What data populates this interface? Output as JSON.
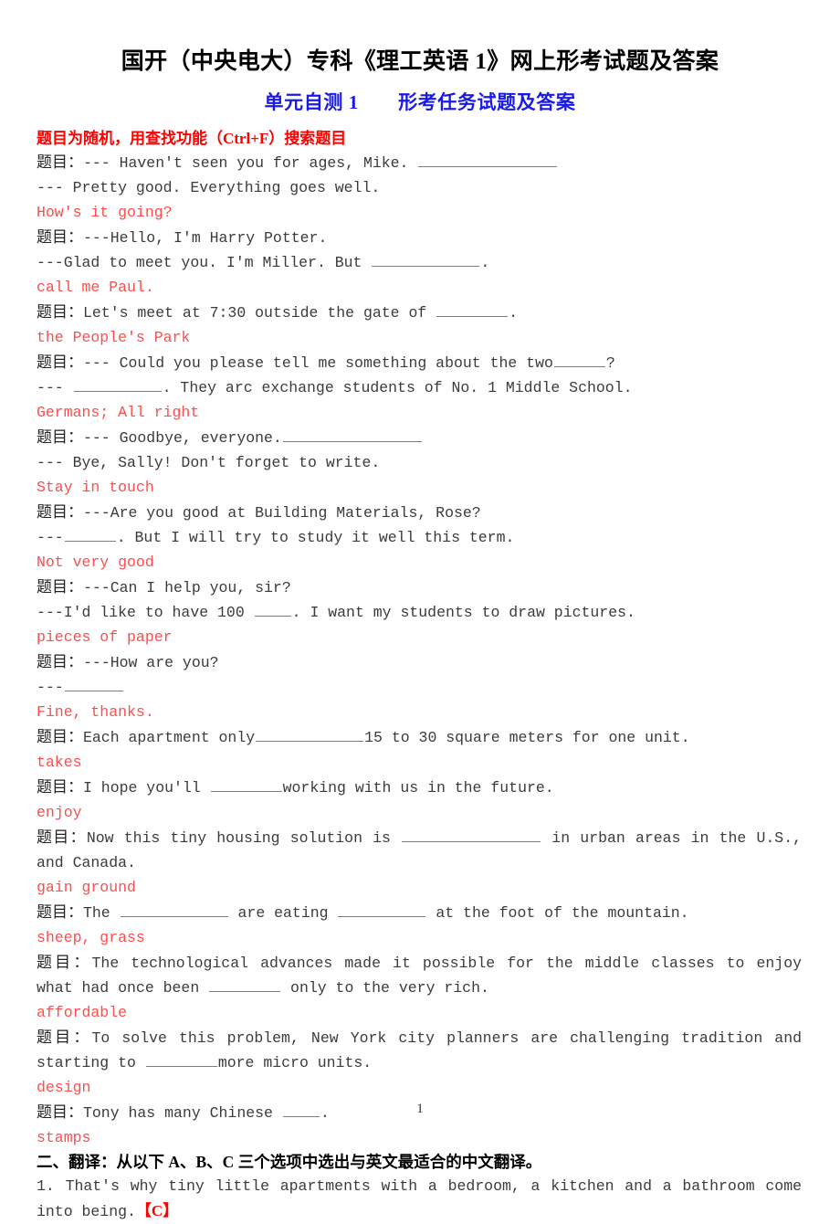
{
  "document": {
    "title": "国开（中央电大）专科《理工英语 1》网上形考试题及答案",
    "subtitle": "单元自测 1　　形考任务试题及答案",
    "notice": "题目为随机，用查找功能（Ctrl+F）搜索题目",
    "page_number": "1"
  },
  "colors": {
    "title": "#000000",
    "subtitle": "#1a1ae6",
    "notice": "#fe0000",
    "question": "#3b3b3b",
    "answer": "#fe4d4d",
    "answer_mark": "#fe0000",
    "blank_rule": "#7d7d7d",
    "background": "#ffffff"
  },
  "items": [
    {
      "label": "题目：",
      "q_line1_pre": "--- Haven't seen you for ages, Mike. ",
      "q_line1_blank": "xl",
      "q_line1_post": "",
      "q_line2": "--- Pretty good. Everything goes well.",
      "answer": "How's it going?"
    },
    {
      "label": "题目：",
      "q_line1_pre": "---Hello, I'm Harry Potter.",
      "q_line2_pre": "---Glad to meet you. I'm Miller. But ",
      "q_line2_blank": "lg",
      "q_line2_post": ".",
      "answer": "call me Paul."
    },
    {
      "label": "题目：",
      "q_line1_pre": "Let's meet at 7:30 outside the gate of ",
      "q_line1_blank": "sm",
      "q_line1_post": ".",
      "answer": "the People's Park"
    },
    {
      "label": "题目：",
      "q_line1_pre": "--- Could you please tell me something about the two",
      "q_line1_blank": "xs",
      "q_line1_post": "?",
      "q_line2_pre": "--- ",
      "q_line2_blank": "md",
      "q_line2_post": ". They arc exchange students of No. 1 Middle School.",
      "answer": "Germans; All right"
    },
    {
      "label": "题目：",
      "q_line1_pre": "--- Goodbye, everyone.",
      "q_line1_blank": "xl",
      "q_line1_post": "",
      "q_line2": "--- Bye, Sally! Don't forget to write.",
      "answer": "Stay in touch"
    },
    {
      "label": "题目：",
      "q_line1_pre": "---Are you good at Building Materials, Rose?",
      "q_line2_pre": "---",
      "q_line2_blank": "xs",
      "q_line2_post": ". But I will try to study it well this term.",
      "answer": "Not very good"
    },
    {
      "label": "题目：",
      "q_line1_pre": "---Can I help you, sir?",
      "q_line2_pre": "---I'd like to have 100 ",
      "q_line2_blank": "xxs",
      "q_line2_post": ". I want my students to draw pictures.",
      "answer": "pieces of paper"
    },
    {
      "label": "题目：",
      "q_line1_pre": "---How are you?",
      "q_line2_pre": "---",
      "q_line2_blank": "tiny",
      "q_line2_post": "",
      "answer": "Fine, thanks."
    },
    {
      "label": "题目：",
      "q_line1_pre": "Each apartment only",
      "q_line1_blank": "lg",
      "q_line1_post": "15 to 30 square meters for one unit.",
      "answer": "takes"
    },
    {
      "label": "题目：",
      "q_line1_pre": "I hope you'll ",
      "q_line1_blank": "sm",
      "q_line1_post": "working with us in the future.",
      "answer": "enjoy"
    },
    {
      "label": "题目：",
      "q_line1_pre": "Now this tiny housing solution is ",
      "q_line1_blank": "xl",
      "q_line1_post": " in urban areas in the U.S., and Canada.",
      "answer": "gain ground"
    },
    {
      "label": "题目：",
      "q_line1_pre": "The ",
      "q_line1_blank": "lg",
      "q_line1_mid": " are eating ",
      "q_line1_blank2": "md",
      "q_line1_post": " at the foot of the mountain.",
      "answer": "sheep, grass"
    },
    {
      "label": "题目：",
      "q_line1_pre": "The technological advances made it possible for the middle classes to enjoy what had once been ",
      "q_line1_blank": "sm",
      "q_line1_post": " only to the very rich.",
      "answer": "affordable"
    },
    {
      "label": "题目：",
      "q_line1_pre": "To solve this problem, New York city planners are challenging tradition and starting to ",
      "q_line1_blank": "sm",
      "q_line1_post": "more micro units.",
      "answer": "design"
    },
    {
      "label": "题目：",
      "q_line1_pre": "Tony has many Chinese ",
      "q_line1_blank": "xxs",
      "q_line1_post": ".",
      "answer": "stamps"
    }
  ],
  "section_two": {
    "heading": "二、翻译：从以下 A、B、C 三个选项中选出与英文最适合的中文翻译。",
    "items": [
      {
        "number": "1.",
        "text": "That's why tiny little apartments with a bedroom, a kitchen and a bathroom come into being.",
        "answer_mark": "【C】"
      }
    ]
  }
}
